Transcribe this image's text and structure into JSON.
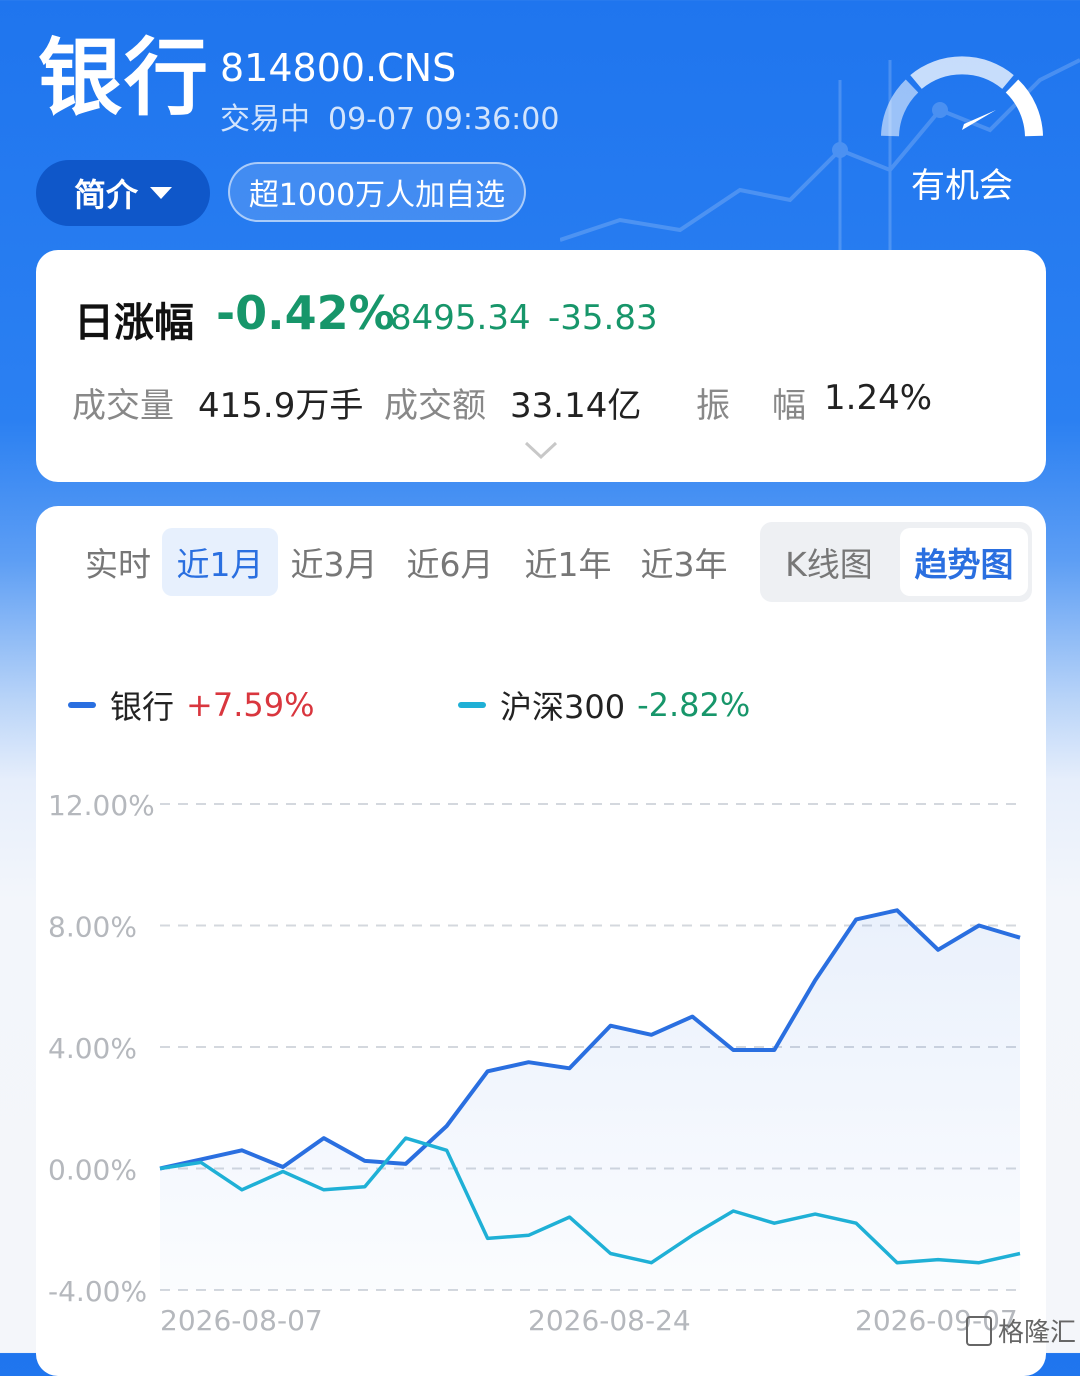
{
  "header": {
    "title": "银行",
    "code": "814800.CNS",
    "status": "交易中",
    "datetime": "09-07 09:36:00",
    "intro_label": "简介",
    "follow_label": "超1000万人加自选",
    "gauge_label": "有机会"
  },
  "summary": {
    "label": "日涨幅",
    "change_pct": "-0.42%",
    "price": "8495.34",
    "change": "-35.83",
    "volume_label": "成交量",
    "volume": "415.9万手",
    "amount_label": "成交额",
    "amount": "33.14亿",
    "amp_label_1": "振",
    "amp_label_2": "幅",
    "amplitude": "1.24%"
  },
  "tabs": [
    "实时",
    "近1月",
    "近3月",
    "近6月",
    "近1年",
    "近3年"
  ],
  "active_tab": "近1月",
  "view_toggle": {
    "kline": "K线图",
    "trend": "趋势图",
    "active": "趋势图"
  },
  "colors": {
    "up": "#d9363e",
    "down": "#17966a",
    "bank_line": "#2a6fe0",
    "index_line": "#1fb0d6",
    "brand": "#1f75ee"
  },
  "chart_data": {
    "type": "line",
    "ylim": [
      -4,
      12
    ],
    "yticks": [
      "12.00%",
      "8.00%",
      "4.00%",
      "0.00%",
      "-4.00%"
    ],
    "ytick_values": [
      12,
      8,
      4,
      0,
      -4
    ],
    "xtick_labels": [
      "2026-08-07",
      "2026-08-24",
      "2026-09-07"
    ],
    "grid": true,
    "legend_position": "top-left",
    "series": [
      {
        "name": "银行",
        "legend_value": "+7.59%",
        "values": [
          0,
          0.3,
          0.6,
          0.05,
          1.0,
          0.25,
          0.15,
          1.4,
          3.2,
          3.5,
          3.3,
          4.7,
          4.4,
          5.0,
          3.9,
          3.9,
          6.2,
          8.2,
          8.5,
          7.2,
          8.0,
          7.6
        ]
      },
      {
        "name": "沪深300",
        "legend_value": "-2.82%",
        "values": [
          0,
          0.2,
          -0.7,
          -0.1,
          -0.7,
          -0.6,
          1.0,
          0.6,
          -2.3,
          -2.2,
          -1.6,
          -2.8,
          -3.1,
          -2.2,
          -1.4,
          -1.8,
          -1.5,
          -1.8,
          -3.1,
          -3.0,
          -3.1,
          -2.8
        ]
      }
    ]
  },
  "watermark": "格隆汇"
}
